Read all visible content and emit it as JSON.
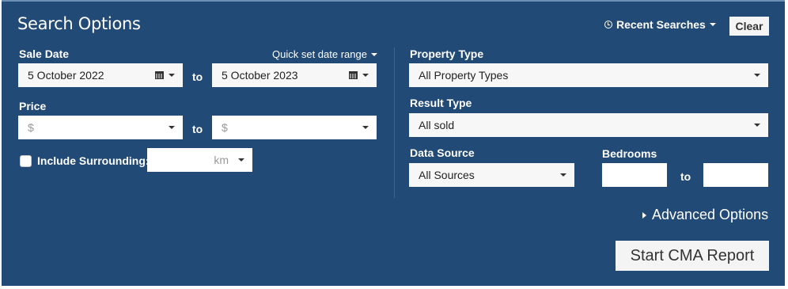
{
  "title": "Search Options",
  "recent_searches": "Recent Searches",
  "clear": "Clear",
  "sale_date": {
    "label": "Sale Date",
    "quick_set": "Quick set date range",
    "from": "5 October 2022",
    "to_word": "to",
    "to": "5 October 2023"
  },
  "price": {
    "label": "Price",
    "min_placeholder": "$",
    "to_word": "to",
    "max_placeholder": "$"
  },
  "surrounding": {
    "label": "Include Surrounding:",
    "unit": "km"
  },
  "property_type": {
    "label": "Property Type",
    "value": "All Property Types"
  },
  "result_type": {
    "label": "Result Type",
    "value": "All sold"
  },
  "data_source": {
    "label": "Data Source",
    "value": "All Sources"
  },
  "bedrooms": {
    "label": "Bedrooms",
    "to_word": "to"
  },
  "advanced_options": "Advanced Options",
  "start_button": "Start CMA Report"
}
